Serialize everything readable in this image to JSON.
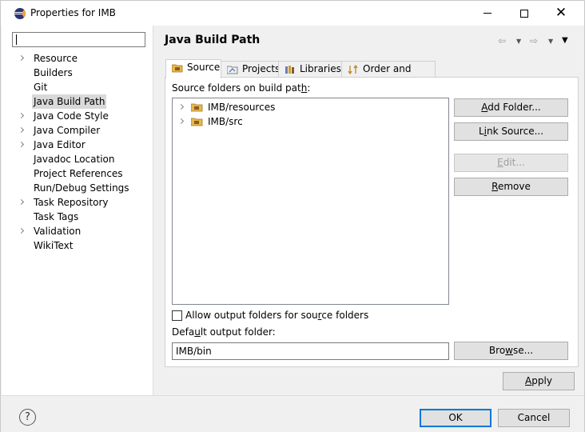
{
  "window": {
    "title": "Properties for IMB"
  },
  "background": {
    "frag_o": "o",
    "frag_e": "e",
    "frag_r": "R",
    "frag_colon": ":",
    "frag_dot": ".",
    "frag_paren": ")"
  },
  "nav": {
    "filter_value": "",
    "items": [
      {
        "label": "Resource",
        "expandable": true
      },
      {
        "label": "Builders",
        "expandable": false
      },
      {
        "label": "Git",
        "expandable": false
      },
      {
        "label": "Java Build Path",
        "expandable": false,
        "selected": true
      },
      {
        "label": "Java Code Style",
        "expandable": true
      },
      {
        "label": "Java Compiler",
        "expandable": true
      },
      {
        "label": "Java Editor",
        "expandable": true
      },
      {
        "label": "Javadoc Location",
        "expandable": false
      },
      {
        "label": "Project References",
        "expandable": false
      },
      {
        "label": "Run/Debug Settings",
        "expandable": false
      },
      {
        "label": "Task Repository",
        "expandable": true
      },
      {
        "label": "Task Tags",
        "expandable": false
      },
      {
        "label": "Validation",
        "expandable": true
      },
      {
        "label": "WikiText",
        "expandable": false
      }
    ]
  },
  "main": {
    "title": "Java Build Path",
    "tabs": [
      {
        "label": "Source",
        "icon": "source-folder-icon",
        "active": true
      },
      {
        "label": "Projects",
        "icon": "projects-icon",
        "active": false
      },
      {
        "label": "Libraries",
        "icon": "libraries-icon",
        "active": false
      },
      {
        "label": "Order and Export",
        "icon": "order-export-icon",
        "active": false
      }
    ],
    "source_folders_label_pre": "Source folders on build pat",
    "source_folders_label_u": "h",
    "source_folders_label_post": ":",
    "source_folders": [
      {
        "label": "IMB/resources"
      },
      {
        "label": "IMB/src"
      }
    ],
    "buttons": {
      "add_folder_u": "A",
      "add_folder_rest": "dd Folder...",
      "link_source_pre": "L",
      "link_source_u": "i",
      "link_source_rest": "nk Source...",
      "edit_u": "E",
      "edit_rest": "dit...",
      "remove_u": "R",
      "remove_rest": "emove",
      "browse_pre": "Bro",
      "browse_u": "w",
      "browse_rest": "se..."
    },
    "allow_output_pre": "Allow output folders for sou",
    "allow_output_u": "r",
    "allow_output_post": "ce folders",
    "allow_output_checked": false,
    "default_output_pre": "Defa",
    "default_output_u": "u",
    "default_output_post": "lt output folder:",
    "default_output_value": "IMB/bin",
    "apply_u": "A",
    "apply_rest": "pply"
  },
  "footer": {
    "help_symbol": "?",
    "ok_label": "OK",
    "cancel_label": "Cancel"
  },
  "colors": {
    "accent": "#0078d7",
    "selection": "#d9d9d9"
  }
}
